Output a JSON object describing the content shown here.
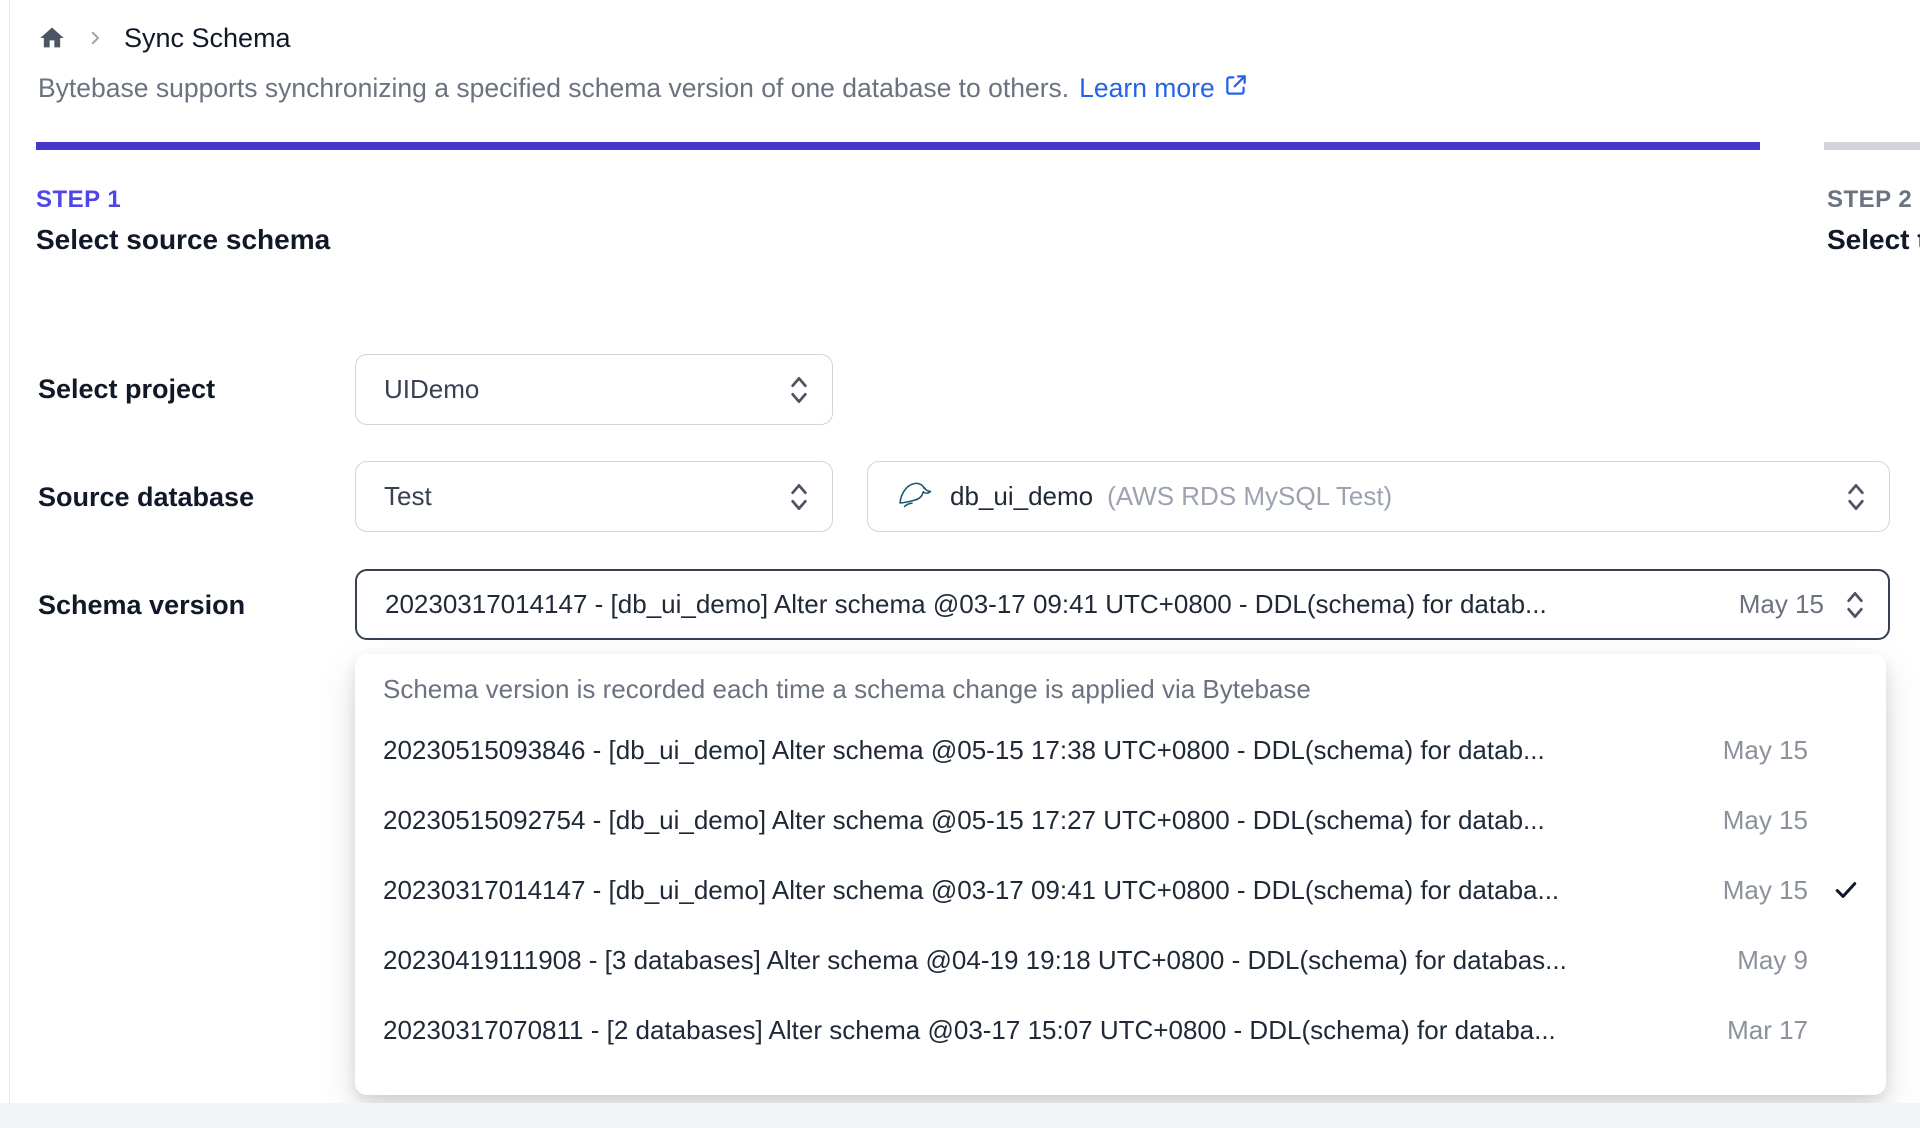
{
  "breadcrumb": {
    "page_title": "Sync Schema"
  },
  "header": {
    "description": "Bytebase supports synchronizing a specified schema version of one database to others.",
    "learn_more_label": "Learn more"
  },
  "steps": {
    "step1": {
      "label": "STEP 1",
      "title": "Select source schema",
      "state": "active"
    },
    "step2": {
      "label": "STEP 2",
      "title": "Select t",
      "state": "upcoming"
    }
  },
  "form": {
    "project": {
      "label": "Select project",
      "value": "UIDemo"
    },
    "source_database": {
      "label": "Source database",
      "environment_value": "Test",
      "database_value": "db_ui_demo",
      "database_instance": "(AWS RDS MySQL Test)"
    },
    "schema_version": {
      "label": "Schema version",
      "selected_text": "20230317014147 - [db_ui_demo] Alter schema @03-17 09:41 UTC+0800 - DDL(schema) for datab...",
      "selected_date": "May 15"
    }
  },
  "dropdown": {
    "hint": "Schema version is recorded each time a schema change is applied via Bytebase",
    "items": [
      {
        "text": "20230515093846 - [db_ui_demo] Alter schema @05-15 17:38 UTC+0800 - DDL(schema) for datab...",
        "date": "May 15",
        "selected": false
      },
      {
        "text": "20230515092754 - [db_ui_demo] Alter schema @05-15 17:27 UTC+0800 - DDL(schema) for datab...",
        "date": "May 15",
        "selected": false
      },
      {
        "text": "20230317014147 - [db_ui_demo] Alter schema @03-17 09:41 UTC+0800 - DDL(schema) for databa...",
        "date": "May 15",
        "selected": true
      },
      {
        "text": "20230419111908 - [3 databases] Alter schema @04-19 19:18 UTC+0800 - DDL(schema) for databas...",
        "date": "May 9",
        "selected": false
      },
      {
        "text": "20230317070811 - [2 databases] Alter schema @03-17 15:07 UTC+0800 - DDL(schema) for databa...",
        "date": "Mar 17",
        "selected": false
      }
    ]
  },
  "icons": {
    "home": "home-icon",
    "breadcrumb_separator": "chevron-right-icon",
    "external_link": "external-link-icon",
    "select_arrows": "updown-chevrons-icon",
    "database_engine": "mysql-dolphin-icon",
    "selected_item": "check-icon"
  },
  "colors": {
    "accent_indigo": "#4338ca",
    "step_active": "#4f46e5",
    "link_blue": "#2563eb",
    "focus_border": "#374151",
    "border_gray": "#d1d5db",
    "text_muted": "#6b7280",
    "date_muted": "#8b929c"
  }
}
